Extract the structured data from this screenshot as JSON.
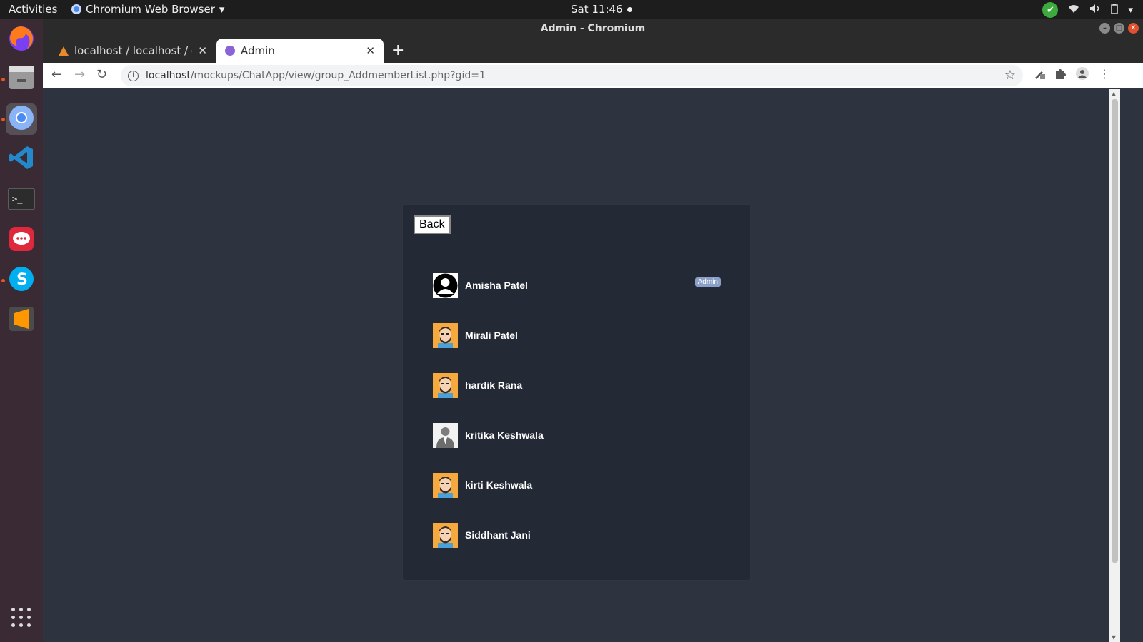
{
  "topbar": {
    "activities": "Activities",
    "app_name": "Chromium Web Browser",
    "clock": "Sat 11:46"
  },
  "window": {
    "title": "Admin - Chromium"
  },
  "tabs": [
    {
      "title": "localhost / localhost / cha",
      "favicon": "warning-icon"
    },
    {
      "title": "Admin",
      "favicon": "admin-app-icon"
    }
  ],
  "address_bar": {
    "host": "localhost",
    "path": "/mockups/ChatApp/view/group_AddmemberList.php?gid=1"
  },
  "card": {
    "back_label": "Back"
  },
  "members": [
    {
      "name": "Amisha Patel",
      "avatar": "anonymous-avatar",
      "badge": "Admin"
    },
    {
      "name": "Mirali Patel",
      "avatar": "bitmoji-avatar"
    },
    {
      "name": "hardik Rana",
      "avatar": "bitmoji-avatar"
    },
    {
      "name": "kritika Keshwala",
      "avatar": "suit-avatar"
    },
    {
      "name": "kirti Keshwala",
      "avatar": "bitmoji-avatar"
    },
    {
      "name": "Siddhant Jani",
      "avatar": "bitmoji-avatar"
    }
  ],
  "colors": {
    "page_bg": "#2d333f",
    "card_bg": "#242936",
    "badge_bg": "#8aa0c8"
  }
}
